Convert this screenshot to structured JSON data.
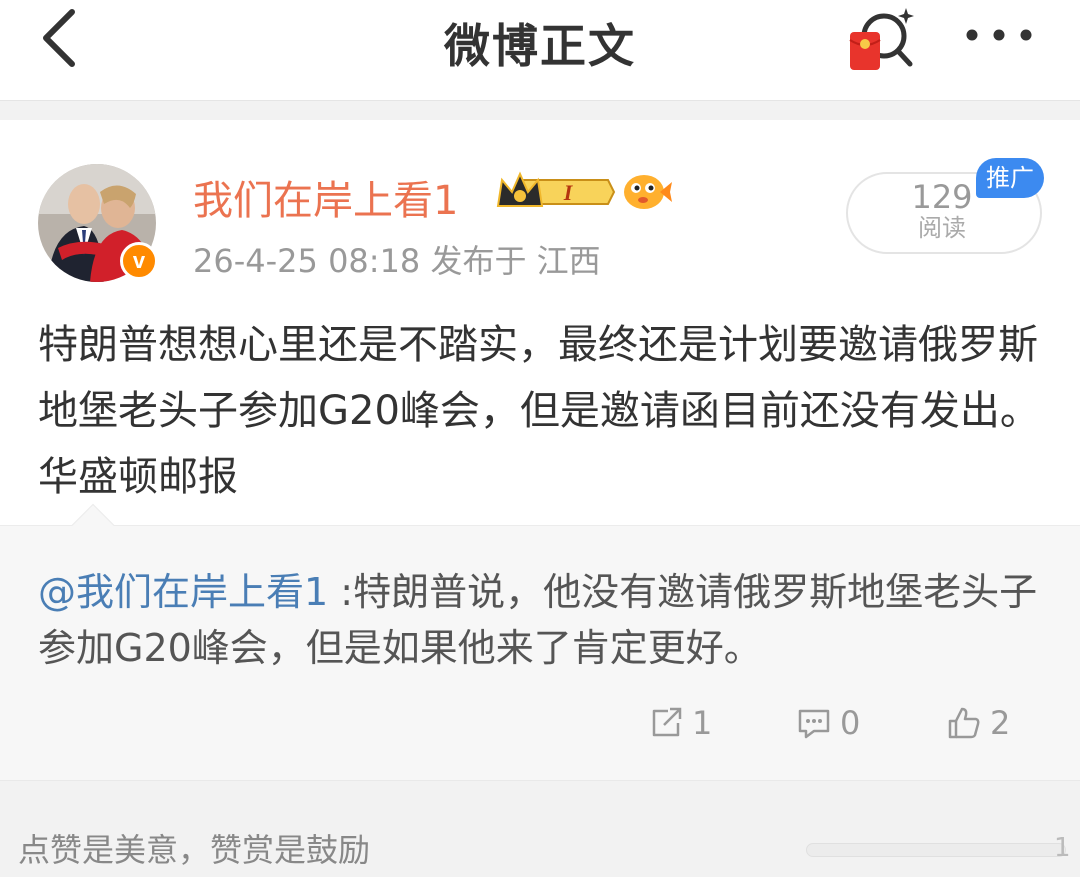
{
  "header": {
    "title": "微博正文",
    "icons": {
      "back": "chevron-left-icon",
      "redpacket_search": "red-packet-search-icon",
      "more": "more-dots-icon"
    }
  },
  "post": {
    "username": "我们在岸上看1",
    "badge_level": "I",
    "time": "26-4-25 08:18",
    "source": "发布于 江西",
    "read_count": "129",
    "read_label": "阅读",
    "promo_tag": "推广",
    "text": "特朗普想想心里还是不踏实，最终还是计划要邀请俄罗斯地堡老头子参加G20峰会，但是邀请函目前还没有发出。 华盛顿邮报",
    "verified_badge": "v"
  },
  "retweet": {
    "user": "@我们在岸上看1",
    "text": " :特朗普说，他没有邀请俄罗斯地堡老头子参加G20峰会，但是如果他来了肯定更好。",
    "repost_count": "1",
    "comment_count": "0",
    "like_count": "2"
  },
  "footer": {
    "reward_text": "点赞是美意，赞赏是鼓励",
    "slider_end": "1"
  },
  "colors": {
    "username": "#eb7350",
    "link": "#4a7eb5",
    "promo": "#3c8af0",
    "verified": "#ff8a00"
  }
}
